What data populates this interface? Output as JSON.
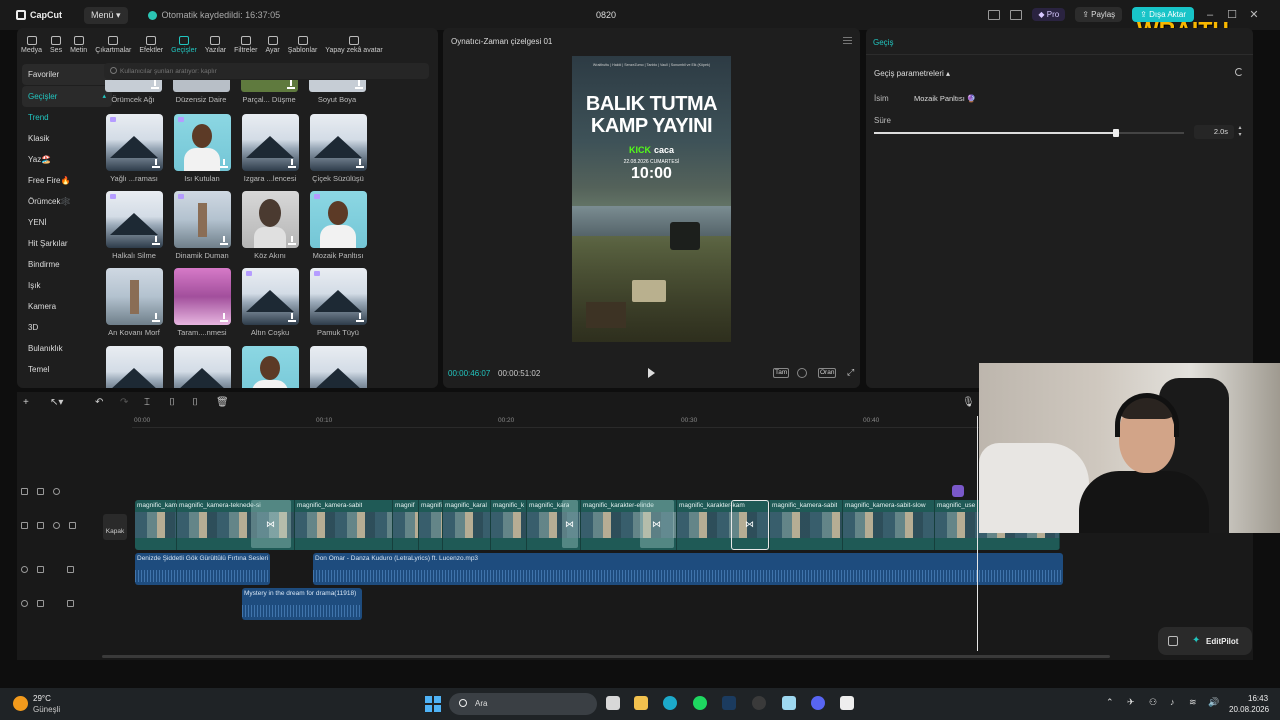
{
  "titlebar": {
    "logo": "CapCut",
    "menu": "Menü",
    "autosave": "Otomatik kaydedildi: 16:37:05",
    "project": "0820",
    "pro": "Pro",
    "share": "Paylaş",
    "export": "Dışa Aktar"
  },
  "toolbar": {
    "items": [
      "Medya",
      "Ses",
      "Metin",
      "Çıkartmalar",
      "Efektler",
      "Geçişler",
      "Yazılar",
      "Filtreler",
      "Ayar",
      "Şablonlar",
      "Yapay zekâ avatar"
    ]
  },
  "sidebar": {
    "favorites": "Favoriler",
    "transitions": "Geçişler",
    "items": [
      "Trend",
      "Klasik",
      "Yaz🏖️",
      "Free Fire🔥",
      "Örümcek🕸️",
      "YENİ",
      "Hit Şarkılar",
      "Bindirme",
      "Işık",
      "Kamera",
      "3D",
      "Bulanıklık",
      "Temel"
    ]
  },
  "search": {
    "placeholder": "Kullanıcılar şunları aratıyor: kaplır"
  },
  "grid": {
    "top_labels": [
      "Örümcek Ağı",
      "Düzensiz Daire",
      "Parçal... Düşme",
      "Soyut Boya"
    ],
    "rows": [
      [
        "Yağlı ...raması",
        "Isı Kutulan",
        "Izgara ...lencesi",
        "Çiçek Süzülüşü"
      ],
      [
        "Halkalı Silme",
        "Dinamik Duman",
        "Köz Akını",
        "Mozaik Panltısı"
      ],
      [
        "An Kovanı Morf",
        "Taram....nmesi",
        "Altın Coşku",
        "Pamuk Tüyü"
      ]
    ]
  },
  "player": {
    "title": "Oynatıcı-Zaman çizelgesi 01",
    "current_time": "00:00:46:07",
    "total_time": "00:00:51:02",
    "full": "Tam",
    "ratio": "Oran",
    "video": {
      "small_text": "Wraithuttu | Haldıl | SenzeZumo | Tanblo | Vaull | Sonumbil ve Elk (Köpek)",
      "title_line1": "BALIK TUTMA",
      "title_line2": "KAMP YAYINI",
      "kick": "KICK",
      "channel": "caca",
      "date": "22.08.2026 CUMARTESİ",
      "time": "10:00"
    }
  },
  "inspector": {
    "tab": "Geçiş",
    "section": "Geçiş parametreleri",
    "name_label": "İsim",
    "name_value": "Mozaik Panltısı 🔮",
    "duration_label": "Süre",
    "duration_value": "2.0s",
    "duration_fraction": 0.78
  },
  "timeline": {
    "ruler": [
      "00:00",
      "00:10",
      "00:20",
      "00:30",
      "00:40"
    ],
    "cover": "Kapak",
    "clips": [
      "magnific_kam",
      "magnific_kamera-teknede-si",
      "magnific_kamera-sabit",
      "magnif",
      "magnifi",
      "magnific_karal",
      "magnific_k",
      "magnific_kara",
      "magnific_karakter-elinde",
      "magnific_karakter-kam",
      "magnific_kamera-sabit",
      "magnific_kamera-sabit-slow",
      "magnific_use"
    ],
    "audio": [
      "Denizde Şiddetli Gök Gürültülü Fırtına Sesleri",
      "Don Omar - Danza Kuduro (LetraLyrics) ft. Lucenzo.mp3",
      "Mystery in the dream for drama(11918)"
    ]
  },
  "editpilot": "EditPilot",
  "overlay_logo": "WRAITH",
  "taskbar": {
    "temp": "29°C",
    "condition": "Güneşli",
    "search": "Ara",
    "time": "16:43",
    "date": "20.08.2026"
  },
  "colors": {
    "accent": "#22c6c0",
    "export": "#18c4c8",
    "video_track": "#1f5a56",
    "audio_track": "#1e4c7e",
    "wraith": "#f8b700"
  }
}
